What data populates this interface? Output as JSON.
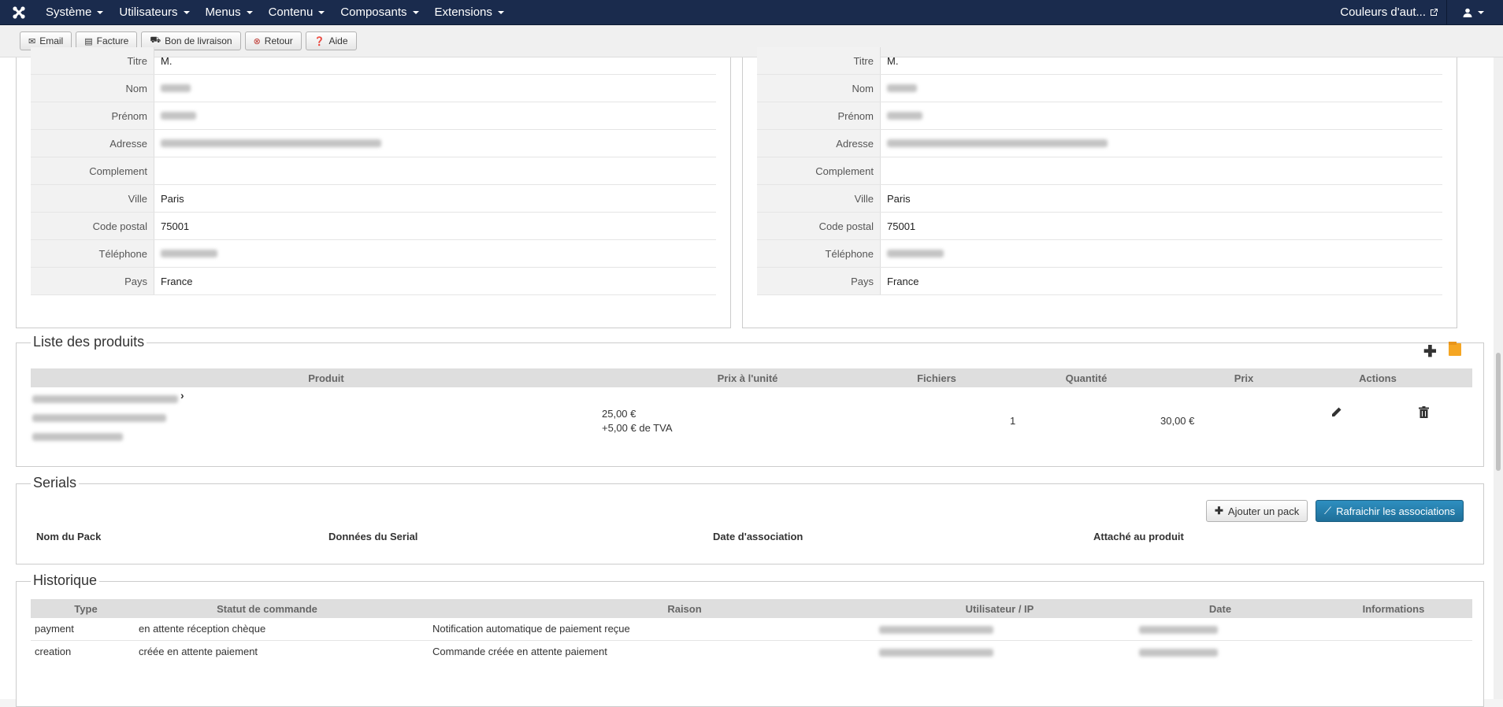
{
  "navbar": {
    "items": [
      {
        "label": "Système"
      },
      {
        "label": "Utilisateurs"
      },
      {
        "label": "Menus"
      },
      {
        "label": "Contenu"
      },
      {
        "label": "Composants"
      },
      {
        "label": "Extensions"
      }
    ],
    "site_link": "Couleurs d'aut..."
  },
  "toolbar": {
    "email": "Email",
    "facture": "Facture",
    "bon_livraison": "Bon de livraison",
    "retour": "Retour",
    "aide": "Aide"
  },
  "address_labels": {
    "titre": "Titre",
    "nom": "Nom",
    "prenom": "Prénom",
    "adresse": "Adresse",
    "complement": "Complement",
    "ville": "Ville",
    "code_postal": "Code postal",
    "telephone": "Téléphone",
    "pays": "Pays"
  },
  "billing": {
    "titre": "M.",
    "ville": "Paris",
    "code_postal": "75001",
    "pays": "France"
  },
  "shipping": {
    "titre": "M.",
    "ville": "Paris",
    "code_postal": "75001",
    "pays": "France"
  },
  "products": {
    "title": "Liste des produits",
    "headers": {
      "produit": "Produit",
      "prix_unite": "Prix à l'unité",
      "fichiers": "Fichiers",
      "quantite": "Quantité",
      "prix": "Prix",
      "actions": "Actions"
    },
    "rows": [
      {
        "unit_price": "25,00 €",
        "tax": "+5,00 € de TVA",
        "quantity": "1",
        "price": "30,00 €"
      }
    ]
  },
  "serials": {
    "title": "Serials",
    "add_pack": "Ajouter un pack",
    "refresh": "Rafraichir les associations",
    "headers": {
      "pack": "Nom du Pack",
      "data": "Données du Serial",
      "date": "Date d'association",
      "product": "Attaché au produit"
    }
  },
  "history": {
    "title": "Historique",
    "headers": {
      "type": "Type",
      "status": "Statut de commande",
      "reason": "Raison",
      "user": "Utilisateur / IP",
      "date": "Date",
      "info": "Informations"
    },
    "rows": [
      {
        "type": "payment",
        "status": "en attente réception chèque",
        "reason": "Notification automatique de paiement reçue"
      },
      {
        "type": "creation",
        "status": "créée en attente paiement",
        "reason": "Commande créée en attente paiement"
      }
    ]
  },
  "colors": {
    "navbar": "#1a2b4d",
    "primary_button": "#1f6f99"
  }
}
